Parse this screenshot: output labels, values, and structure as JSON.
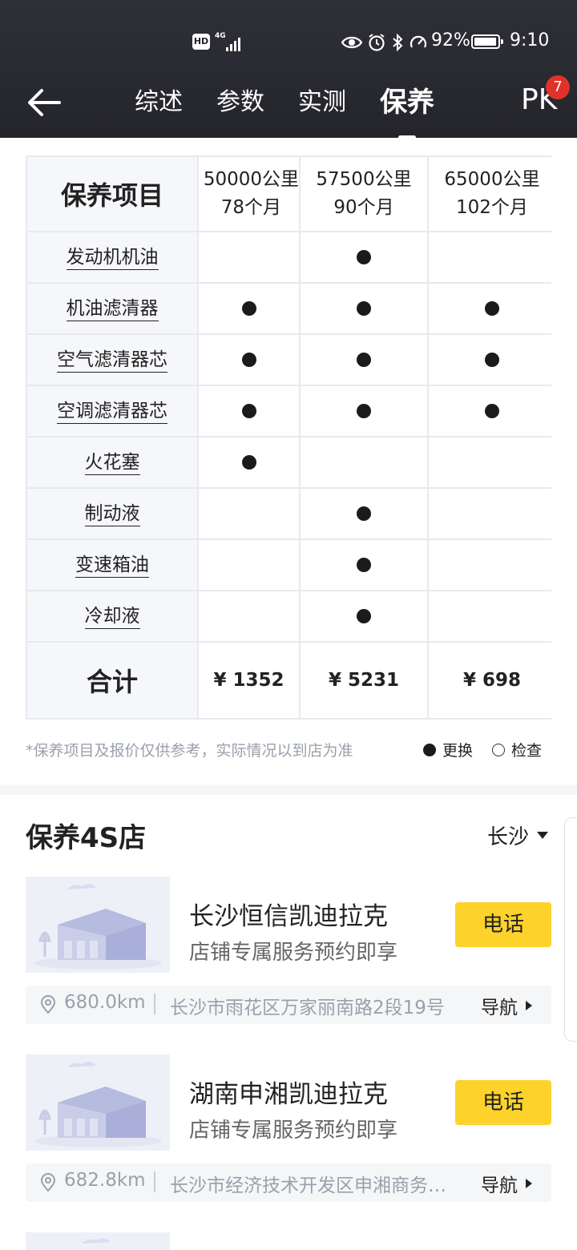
{
  "status": {
    "hd": "HD",
    "network": "4G",
    "battery": "92%",
    "time": "9:10"
  },
  "nav": {
    "tabs": [
      {
        "label": "综述",
        "active": false
      },
      {
        "label": "参数",
        "active": false
      },
      {
        "label": "实测",
        "active": false
      },
      {
        "label": "保养",
        "active": true
      }
    ],
    "pk": "PK",
    "pk_badge": "7"
  },
  "maintenance": {
    "header_label": "保养项目",
    "columns": [
      {
        "mileage": "50000公里",
        "months": "78个月"
      },
      {
        "mileage": "57500公里",
        "months": "90个月"
      },
      {
        "mileage": "65000公里",
        "months": "102个月"
      }
    ],
    "items": [
      {
        "label": "发动机机油",
        "marks": [
          false,
          true,
          false
        ]
      },
      {
        "label": "机油滤清器",
        "marks": [
          true,
          true,
          true
        ]
      },
      {
        "label": "空气滤清器芯",
        "marks": [
          true,
          true,
          true
        ]
      },
      {
        "label": "空调滤清器芯",
        "marks": [
          true,
          true,
          true
        ]
      },
      {
        "label": "火花塞",
        "marks": [
          true,
          false,
          false
        ]
      },
      {
        "label": "制动液",
        "marks": [
          false,
          true,
          false
        ]
      },
      {
        "label": "变速箱油",
        "marks": [
          false,
          true,
          false
        ]
      },
      {
        "label": "冷却液",
        "marks": [
          false,
          true,
          false
        ]
      }
    ],
    "total_label": "合计",
    "totals": [
      "¥ 1352",
      "¥ 5231",
      "¥ 698"
    ],
    "note": "*保养项目及报价仅供参考，实际情况以到店为准",
    "legend_replace": "更换",
    "legend_check": "检查"
  },
  "shops": {
    "title": "保养4S店",
    "city": "长沙",
    "list": [
      {
        "name": "长沙恒信凯迪拉克",
        "subtitle": "店铺专属服务预约即享",
        "call_label": "电话",
        "distance": "680.0km",
        "address": "长沙市雨花区万家丽南路2段19号",
        "nav_label": "导航"
      },
      {
        "name": "湖南申湘凯迪拉克",
        "subtitle": "店铺专属服务预约即享",
        "call_label": "电话",
        "distance": "682.8km",
        "address": "长沙市经济技术开发区申湘商务…",
        "nav_label": "导航"
      }
    ]
  }
}
